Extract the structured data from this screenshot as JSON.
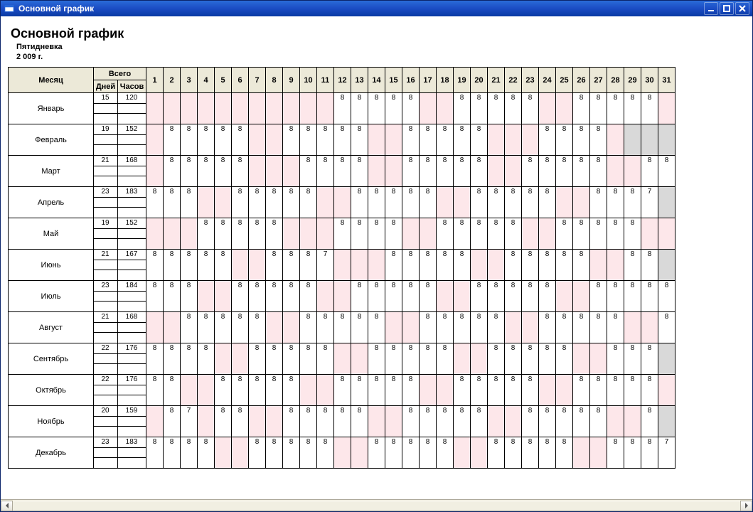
{
  "window": {
    "title": "Основной график"
  },
  "heading": {
    "title": "Основной график",
    "sub1": "Пятидневка",
    "sub2": "2 009 г."
  },
  "headers": {
    "month": "Месяц",
    "total": "Всего",
    "days": "Дней",
    "hours": "Часов"
  },
  "dayNumbers": [
    "1",
    "2",
    "3",
    "4",
    "5",
    "6",
    "7",
    "8",
    "9",
    "10",
    "11",
    "12",
    "13",
    "14",
    "15",
    "16",
    "17",
    "18",
    "19",
    "20",
    "21",
    "22",
    "23",
    "24",
    "25",
    "26",
    "27",
    "28",
    "29",
    "30",
    "31"
  ],
  "months": [
    {
      "name": "Январь",
      "days": "15",
      "hours": "120",
      "cells": [
        {
          "v": "",
          "c": "pink"
        },
        {
          "v": "",
          "c": "pink"
        },
        {
          "v": "",
          "c": "pink"
        },
        {
          "v": "",
          "c": "pink"
        },
        {
          "v": "",
          "c": "pink"
        },
        {
          "v": "",
          "c": "pink"
        },
        {
          "v": "",
          "c": "pink"
        },
        {
          "v": "",
          "c": "pink"
        },
        {
          "v": "",
          "c": "pink"
        },
        {
          "v": "",
          "c": "pink"
        },
        {
          "v": "",
          "c": "pink"
        },
        {
          "v": "8"
        },
        {
          "v": "8"
        },
        {
          "v": "8"
        },
        {
          "v": "8"
        },
        {
          "v": "8"
        },
        {
          "v": "",
          "c": "pink"
        },
        {
          "v": "",
          "c": "pink"
        },
        {
          "v": "8"
        },
        {
          "v": "8"
        },
        {
          "v": "8"
        },
        {
          "v": "8"
        },
        {
          "v": "8"
        },
        {
          "v": "",
          "c": "pink"
        },
        {
          "v": "",
          "c": "pink"
        },
        {
          "v": "8"
        },
        {
          "v": "8"
        },
        {
          "v": "8"
        },
        {
          "v": "8"
        },
        {
          "v": "8"
        },
        {
          "v": "",
          "c": "pink"
        }
      ]
    },
    {
      "name": "Февраль",
      "days": "19",
      "hours": "152",
      "cells": [
        {
          "v": "",
          "c": "pink"
        },
        {
          "v": "8"
        },
        {
          "v": "8"
        },
        {
          "v": "8"
        },
        {
          "v": "8"
        },
        {
          "v": "8"
        },
        {
          "v": "",
          "c": "pink"
        },
        {
          "v": "",
          "c": "pink"
        },
        {
          "v": "8"
        },
        {
          "v": "8"
        },
        {
          "v": "8"
        },
        {
          "v": "8"
        },
        {
          "v": "8"
        },
        {
          "v": "",
          "c": "pink"
        },
        {
          "v": "",
          "c": "pink"
        },
        {
          "v": "8"
        },
        {
          "v": "8"
        },
        {
          "v": "8"
        },
        {
          "v": "8"
        },
        {
          "v": "8"
        },
        {
          "v": "",
          "c": "pink"
        },
        {
          "v": "",
          "c": "pink"
        },
        {
          "v": "",
          "c": "pink"
        },
        {
          "v": "8"
        },
        {
          "v": "8"
        },
        {
          "v": "8"
        },
        {
          "v": "8"
        },
        {
          "v": "",
          "c": "pink"
        },
        {
          "v": "",
          "c": "grey"
        },
        {
          "v": "",
          "c": "grey"
        },
        {
          "v": "",
          "c": "grey"
        }
      ]
    },
    {
      "name": "Март",
      "days": "21",
      "hours": "168",
      "cells": [
        {
          "v": "",
          "c": "pink"
        },
        {
          "v": "8"
        },
        {
          "v": "8"
        },
        {
          "v": "8"
        },
        {
          "v": "8"
        },
        {
          "v": "8"
        },
        {
          "v": "",
          "c": "pink"
        },
        {
          "v": "",
          "c": "pink"
        },
        {
          "v": "",
          "c": "pink"
        },
        {
          "v": "8"
        },
        {
          "v": "8"
        },
        {
          "v": "8"
        },
        {
          "v": "8"
        },
        {
          "v": "",
          "c": "pink"
        },
        {
          "v": "",
          "c": "pink"
        },
        {
          "v": "8"
        },
        {
          "v": "8"
        },
        {
          "v": "8"
        },
        {
          "v": "8"
        },
        {
          "v": "8"
        },
        {
          "v": "",
          "c": "pink"
        },
        {
          "v": "",
          "c": "pink"
        },
        {
          "v": "8"
        },
        {
          "v": "8"
        },
        {
          "v": "8"
        },
        {
          "v": "8"
        },
        {
          "v": "8"
        },
        {
          "v": "",
          "c": "pink"
        },
        {
          "v": "",
          "c": "pink"
        },
        {
          "v": "8"
        },
        {
          "v": "8"
        }
      ]
    },
    {
      "name": "Апрель",
      "days": "23",
      "hours": "183",
      "cells": [
        {
          "v": "8"
        },
        {
          "v": "8"
        },
        {
          "v": "8"
        },
        {
          "v": "",
          "c": "pink"
        },
        {
          "v": "",
          "c": "pink"
        },
        {
          "v": "8"
        },
        {
          "v": "8"
        },
        {
          "v": "8"
        },
        {
          "v": "8"
        },
        {
          "v": "8"
        },
        {
          "v": "",
          "c": "pink"
        },
        {
          "v": "",
          "c": "pink"
        },
        {
          "v": "8"
        },
        {
          "v": "8"
        },
        {
          "v": "8"
        },
        {
          "v": "8"
        },
        {
          "v": "8"
        },
        {
          "v": "",
          "c": "pink"
        },
        {
          "v": "",
          "c": "pink"
        },
        {
          "v": "8"
        },
        {
          "v": "8"
        },
        {
          "v": "8"
        },
        {
          "v": "8"
        },
        {
          "v": "8"
        },
        {
          "v": "",
          "c": "pink"
        },
        {
          "v": "",
          "c": "pink"
        },
        {
          "v": "8"
        },
        {
          "v": "8"
        },
        {
          "v": "8"
        },
        {
          "v": "7"
        },
        {
          "v": "",
          "c": "grey"
        }
      ]
    },
    {
      "name": "Май",
      "days": "19",
      "hours": "152",
      "cells": [
        {
          "v": "",
          "c": "pink"
        },
        {
          "v": "",
          "c": "pink"
        },
        {
          "v": "",
          "c": "pink"
        },
        {
          "v": "8"
        },
        {
          "v": "8"
        },
        {
          "v": "8"
        },
        {
          "v": "8"
        },
        {
          "v": "8"
        },
        {
          "v": "",
          "c": "pink"
        },
        {
          "v": "",
          "c": "pink"
        },
        {
          "v": "",
          "c": "pink"
        },
        {
          "v": "8"
        },
        {
          "v": "8"
        },
        {
          "v": "8"
        },
        {
          "v": "8"
        },
        {
          "v": "",
          "c": "pink"
        },
        {
          "v": "",
          "c": "pink"
        },
        {
          "v": "8"
        },
        {
          "v": "8"
        },
        {
          "v": "8"
        },
        {
          "v": "8"
        },
        {
          "v": "8"
        },
        {
          "v": "",
          "c": "pink"
        },
        {
          "v": "",
          "c": "pink"
        },
        {
          "v": "8"
        },
        {
          "v": "8"
        },
        {
          "v": "8"
        },
        {
          "v": "8"
        },
        {
          "v": "8"
        },
        {
          "v": "",
          "c": "pink"
        },
        {
          "v": "",
          "c": "pink"
        }
      ]
    },
    {
      "name": "Июнь",
      "days": "21",
      "hours": "167",
      "cells": [
        {
          "v": "8"
        },
        {
          "v": "8"
        },
        {
          "v": "8"
        },
        {
          "v": "8"
        },
        {
          "v": "8"
        },
        {
          "v": "",
          "c": "pink"
        },
        {
          "v": "",
          "c": "pink"
        },
        {
          "v": "8"
        },
        {
          "v": "8"
        },
        {
          "v": "8"
        },
        {
          "v": "7"
        },
        {
          "v": "",
          "c": "pink"
        },
        {
          "v": "",
          "c": "pink"
        },
        {
          "v": "",
          "c": "pink"
        },
        {
          "v": "8"
        },
        {
          "v": "8"
        },
        {
          "v": "8"
        },
        {
          "v": "8"
        },
        {
          "v": "8"
        },
        {
          "v": "",
          "c": "pink"
        },
        {
          "v": "",
          "c": "pink"
        },
        {
          "v": "8"
        },
        {
          "v": "8"
        },
        {
          "v": "8"
        },
        {
          "v": "8"
        },
        {
          "v": "8"
        },
        {
          "v": "",
          "c": "pink"
        },
        {
          "v": "",
          "c": "pink"
        },
        {
          "v": "8"
        },
        {
          "v": "8"
        },
        {
          "v": "",
          "c": "grey"
        }
      ]
    },
    {
      "name": "Июль",
      "days": "23",
      "hours": "184",
      "cells": [
        {
          "v": "8"
        },
        {
          "v": "8"
        },
        {
          "v": "8"
        },
        {
          "v": "",
          "c": "pink"
        },
        {
          "v": "",
          "c": "pink"
        },
        {
          "v": "8"
        },
        {
          "v": "8"
        },
        {
          "v": "8"
        },
        {
          "v": "8"
        },
        {
          "v": "8"
        },
        {
          "v": "",
          "c": "pink"
        },
        {
          "v": "",
          "c": "pink"
        },
        {
          "v": "8"
        },
        {
          "v": "8"
        },
        {
          "v": "8"
        },
        {
          "v": "8"
        },
        {
          "v": "8"
        },
        {
          "v": "",
          "c": "pink"
        },
        {
          "v": "",
          "c": "pink"
        },
        {
          "v": "8"
        },
        {
          "v": "8"
        },
        {
          "v": "8"
        },
        {
          "v": "8"
        },
        {
          "v": "8"
        },
        {
          "v": "",
          "c": "pink"
        },
        {
          "v": "",
          "c": "pink"
        },
        {
          "v": "8"
        },
        {
          "v": "8"
        },
        {
          "v": "8"
        },
        {
          "v": "8"
        },
        {
          "v": "8"
        }
      ]
    },
    {
      "name": "Август",
      "days": "21",
      "hours": "168",
      "cells": [
        {
          "v": "",
          "c": "pink"
        },
        {
          "v": "",
          "c": "pink"
        },
        {
          "v": "8"
        },
        {
          "v": "8"
        },
        {
          "v": "8"
        },
        {
          "v": "8"
        },
        {
          "v": "8"
        },
        {
          "v": "",
          "c": "pink"
        },
        {
          "v": "",
          "c": "pink"
        },
        {
          "v": "8"
        },
        {
          "v": "8"
        },
        {
          "v": "8"
        },
        {
          "v": "8"
        },
        {
          "v": "8"
        },
        {
          "v": "",
          "c": "pink"
        },
        {
          "v": "",
          "c": "pink"
        },
        {
          "v": "8"
        },
        {
          "v": "8"
        },
        {
          "v": "8"
        },
        {
          "v": "8"
        },
        {
          "v": "8"
        },
        {
          "v": "",
          "c": "pink"
        },
        {
          "v": "",
          "c": "pink"
        },
        {
          "v": "8"
        },
        {
          "v": "8"
        },
        {
          "v": "8"
        },
        {
          "v": "8"
        },
        {
          "v": "8"
        },
        {
          "v": "",
          "c": "pink"
        },
        {
          "v": "",
          "c": "pink"
        },
        {
          "v": "8"
        }
      ]
    },
    {
      "name": "Сентябрь",
      "days": "22",
      "hours": "176",
      "cells": [
        {
          "v": "8"
        },
        {
          "v": "8"
        },
        {
          "v": "8"
        },
        {
          "v": "8"
        },
        {
          "v": "",
          "c": "pink"
        },
        {
          "v": "",
          "c": "pink"
        },
        {
          "v": "8"
        },
        {
          "v": "8"
        },
        {
          "v": "8"
        },
        {
          "v": "8"
        },
        {
          "v": "8"
        },
        {
          "v": "",
          "c": "pink"
        },
        {
          "v": "",
          "c": "pink"
        },
        {
          "v": "8"
        },
        {
          "v": "8"
        },
        {
          "v": "8"
        },
        {
          "v": "8"
        },
        {
          "v": "8"
        },
        {
          "v": "",
          "c": "pink"
        },
        {
          "v": "",
          "c": "pink"
        },
        {
          "v": "8"
        },
        {
          "v": "8"
        },
        {
          "v": "8"
        },
        {
          "v": "8"
        },
        {
          "v": "8"
        },
        {
          "v": "",
          "c": "pink"
        },
        {
          "v": "",
          "c": "pink"
        },
        {
          "v": "8"
        },
        {
          "v": "8"
        },
        {
          "v": "8"
        },
        {
          "v": "",
          "c": "grey"
        }
      ]
    },
    {
      "name": "Октябрь",
      "days": "22",
      "hours": "176",
      "cells": [
        {
          "v": "8"
        },
        {
          "v": "8"
        },
        {
          "v": "",
          "c": "pink"
        },
        {
          "v": "",
          "c": "pink"
        },
        {
          "v": "8"
        },
        {
          "v": "8"
        },
        {
          "v": "8"
        },
        {
          "v": "8"
        },
        {
          "v": "8"
        },
        {
          "v": "",
          "c": "pink"
        },
        {
          "v": "",
          "c": "pink"
        },
        {
          "v": "8"
        },
        {
          "v": "8"
        },
        {
          "v": "8"
        },
        {
          "v": "8"
        },
        {
          "v": "8"
        },
        {
          "v": "",
          "c": "pink"
        },
        {
          "v": "",
          "c": "pink"
        },
        {
          "v": "8"
        },
        {
          "v": "8"
        },
        {
          "v": "8"
        },
        {
          "v": "8"
        },
        {
          "v": "8"
        },
        {
          "v": "",
          "c": "pink"
        },
        {
          "v": "",
          "c": "pink"
        },
        {
          "v": "8"
        },
        {
          "v": "8"
        },
        {
          "v": "8"
        },
        {
          "v": "8"
        },
        {
          "v": "8"
        },
        {
          "v": "",
          "c": "pink"
        }
      ]
    },
    {
      "name": "Ноябрь",
      "days": "20",
      "hours": "159",
      "cells": [
        {
          "v": "",
          "c": "pink"
        },
        {
          "v": "8"
        },
        {
          "v": "7"
        },
        {
          "v": "",
          "c": "pink"
        },
        {
          "v": "8"
        },
        {
          "v": "8"
        },
        {
          "v": "",
          "c": "pink"
        },
        {
          "v": "",
          "c": "pink"
        },
        {
          "v": "8"
        },
        {
          "v": "8"
        },
        {
          "v": "8"
        },
        {
          "v": "8"
        },
        {
          "v": "8"
        },
        {
          "v": "",
          "c": "pink"
        },
        {
          "v": "",
          "c": "pink"
        },
        {
          "v": "8"
        },
        {
          "v": "8"
        },
        {
          "v": "8"
        },
        {
          "v": "8"
        },
        {
          "v": "8"
        },
        {
          "v": "",
          "c": "pink"
        },
        {
          "v": "",
          "c": "pink"
        },
        {
          "v": "8"
        },
        {
          "v": "8"
        },
        {
          "v": "8"
        },
        {
          "v": "8"
        },
        {
          "v": "8"
        },
        {
          "v": "",
          "c": "pink"
        },
        {
          "v": "",
          "c": "pink"
        },
        {
          "v": "8"
        },
        {
          "v": "",
          "c": "grey"
        }
      ]
    },
    {
      "name": "Декабрь",
      "days": "23",
      "hours": "183",
      "cells": [
        {
          "v": "8"
        },
        {
          "v": "8"
        },
        {
          "v": "8"
        },
        {
          "v": "8"
        },
        {
          "v": "",
          "c": "pink"
        },
        {
          "v": "",
          "c": "pink"
        },
        {
          "v": "8"
        },
        {
          "v": "8"
        },
        {
          "v": "8"
        },
        {
          "v": "8"
        },
        {
          "v": "8"
        },
        {
          "v": "",
          "c": "pink"
        },
        {
          "v": "",
          "c": "pink"
        },
        {
          "v": "8"
        },
        {
          "v": "8"
        },
        {
          "v": "8"
        },
        {
          "v": "8"
        },
        {
          "v": "8"
        },
        {
          "v": "",
          "c": "pink"
        },
        {
          "v": "",
          "c": "pink"
        },
        {
          "v": "8"
        },
        {
          "v": "8"
        },
        {
          "v": "8"
        },
        {
          "v": "8"
        },
        {
          "v": "8"
        },
        {
          "v": "",
          "c": "pink"
        },
        {
          "v": "",
          "c": "pink"
        },
        {
          "v": "8"
        },
        {
          "v": "8"
        },
        {
          "v": "8"
        },
        {
          "v": "7"
        }
      ]
    }
  ]
}
